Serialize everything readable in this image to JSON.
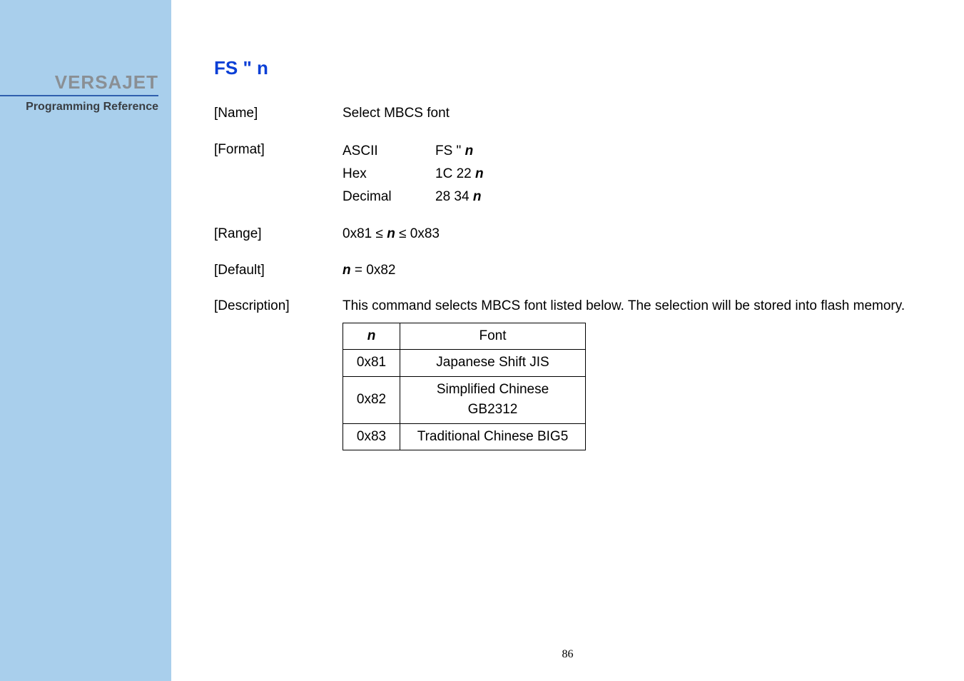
{
  "sidebar": {
    "brand": "VERSAJET",
    "subtitle": "Programming Reference"
  },
  "command": {
    "title": "FS \" n"
  },
  "sections": {
    "name": {
      "label": "[Name]",
      "value": "Select MBCS font"
    },
    "format": {
      "label": "[Format]",
      "rows": [
        {
          "enc": "ASCII",
          "val_prefix": "FS \" ",
          "val_n": "n"
        },
        {
          "enc": "Hex",
          "val_prefix": "1C 22 ",
          "val_n": "n"
        },
        {
          "enc": "Decimal",
          "val_prefix": "28 34 ",
          "val_n": "n"
        }
      ]
    },
    "range": {
      "label": "[Range]",
      "prefix": "0x81 ≤ ",
      "n": "n",
      "suffix": " ≤ 0x83"
    },
    "default": {
      "label": "[Default]",
      "n": "n",
      "suffix": " = 0x82"
    },
    "description": {
      "label": "[Description]",
      "text": "This command selects MBCS font listed below. The selection will be stored into flash memory."
    }
  },
  "font_table": {
    "head_n": "n",
    "head_font": "Font",
    "rows": [
      {
        "n": "0x81",
        "font": "Japanese Shift JIS"
      },
      {
        "n": "0x82",
        "font": "Simplified Chinese GB2312"
      },
      {
        "n": "0x83",
        "font": "Traditional Chinese BIG5"
      }
    ]
  },
  "page_number": "86",
  "chart_data": {
    "type": "table",
    "title": "MBCS font selection",
    "columns": [
      "n",
      "Font"
    ],
    "rows": [
      [
        "0x81",
        "Japanese Shift JIS"
      ],
      [
        "0x82",
        "Simplified Chinese GB2312"
      ],
      [
        "0x83",
        "Traditional Chinese BIG5"
      ]
    ]
  }
}
